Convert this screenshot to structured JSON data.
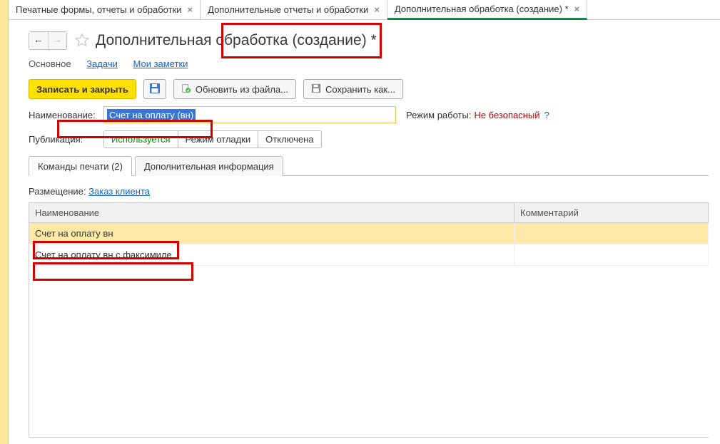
{
  "tabs": [
    {
      "label": "Печатные формы, отчеты и обработки",
      "active": false
    },
    {
      "label": "Дополнительные отчеты и обработки",
      "active": false
    },
    {
      "label": "Дополнительная обработка (создание) *",
      "active": true
    }
  ],
  "page_title": "Дополнительная обработка (создание) *",
  "section_tabs": {
    "main": "Основное",
    "tasks": "Задачи",
    "notes": "Мои заметки"
  },
  "toolbar": {
    "save_close": "Записать и закрыть",
    "update_from_file": "Обновить из файла...",
    "save_as": "Сохранить как..."
  },
  "fields": {
    "name_label": "Наименование:",
    "name_value": "Счет на оплату (вн)",
    "mode_label": "Режим работы:",
    "mode_value": "Не безопасный",
    "help": "?",
    "pub_label": "Публикация:"
  },
  "pub_options": {
    "used": "Используется",
    "debug": "Режим отладки",
    "off": "Отключена"
  },
  "inner_tabs": {
    "print_cmds": "Команды печати (2)",
    "add_info": "Дополнительная информация"
  },
  "placement": {
    "label": "Размещение:",
    "value": "Заказ клиента"
  },
  "grid": {
    "col_name": "Наименование",
    "col_comment": "Комментарий",
    "rows": [
      {
        "name": "Счет на оплату вн",
        "comment": "",
        "selected": true
      },
      {
        "name": "Счет на оплату вн с факсимиле",
        "comment": "",
        "selected": false
      }
    ]
  }
}
